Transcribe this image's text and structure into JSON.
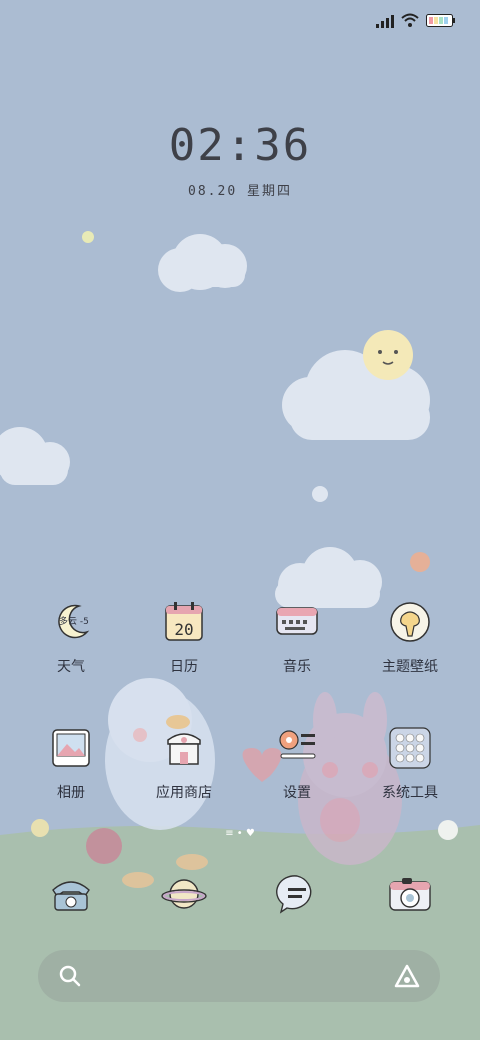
{
  "clock": {
    "time": "02:36",
    "date": "08.20 星期四"
  },
  "apps": [
    {
      "label": "天气",
      "weather_text": "多云 -5"
    },
    {
      "label": "日历",
      "calendar_day": "20"
    },
    {
      "label": "音乐"
    },
    {
      "label": "主题壁纸"
    },
    {
      "label": "相册"
    },
    {
      "label": "应用商店"
    },
    {
      "label": "设置"
    },
    {
      "label": "系统工具"
    }
  ],
  "dock": [
    "phone-icon",
    "browser-icon",
    "messages-icon",
    "camera-icon"
  ],
  "colors": {
    "sky": "#abbcd2",
    "ground": "#a9bfae",
    "text": "#2f3340"
  }
}
